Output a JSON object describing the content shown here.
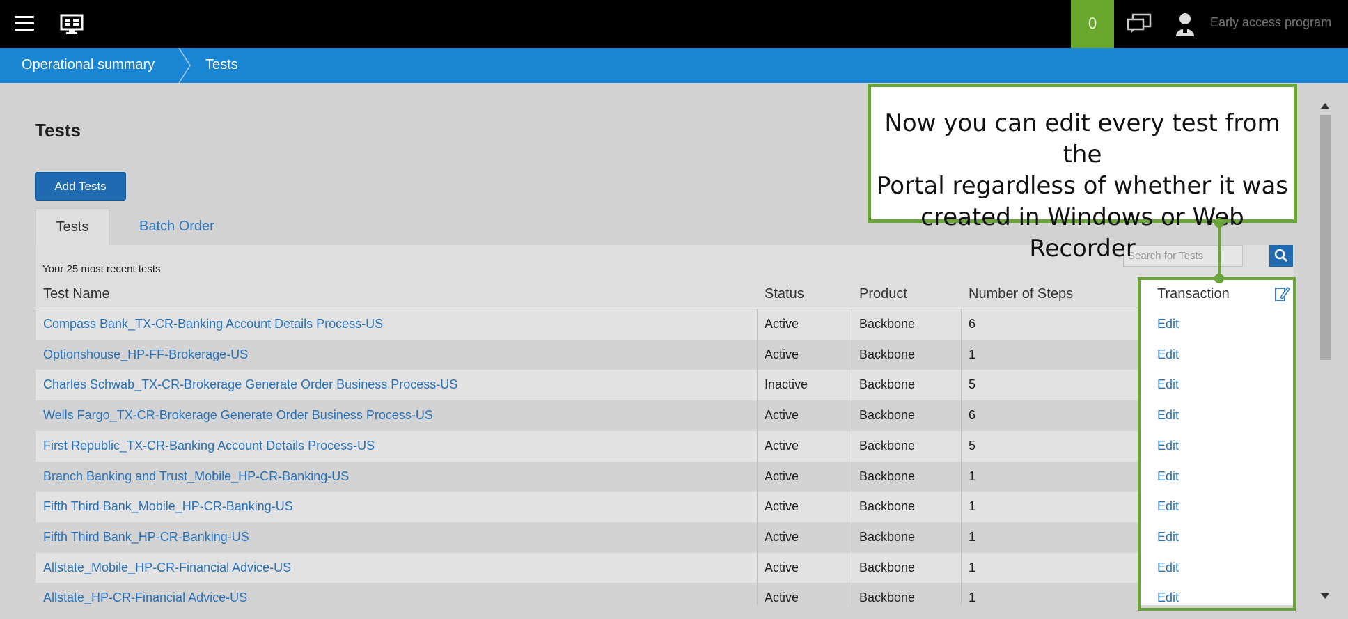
{
  "topbar": {
    "notification_count": "0",
    "early_access_label": "Early access program",
    "brand_green": "#6aa72d"
  },
  "breadcrumb": {
    "items": [
      "Operational summary",
      "Tests"
    ],
    "background": "#1a86d3"
  },
  "page": {
    "title": "Tests",
    "add_button_label": "Add Tests",
    "tabs": [
      {
        "label": "Tests",
        "active": true
      },
      {
        "label": "Batch Order",
        "active": false
      }
    ],
    "recent_label": "Your 25 most recent tests",
    "search_placeholder": "Search for Tests"
  },
  "table": {
    "headers": {
      "name": "Test Name",
      "status": "Status",
      "product": "Product",
      "steps": "Number of Steps",
      "transaction": "Transaction"
    },
    "rows": [
      {
        "name": "Compass Bank_TX-CR-Banking Account Details Process-US",
        "status": "Active",
        "product": "Backbone",
        "steps": "6",
        "action": "Edit"
      },
      {
        "name": "Optionshouse_HP-FF-Brokerage-US",
        "status": "Active",
        "product": "Backbone",
        "steps": "1",
        "action": "Edit"
      },
      {
        "name": "Charles Schwab_TX-CR-Brokerage Generate Order Business Process-US",
        "status": "Inactive",
        "product": "Backbone",
        "steps": "5",
        "action": "Edit"
      },
      {
        "name": "Wells Fargo_TX-CR-Brokerage Generate Order Business Process-US",
        "status": "Active",
        "product": "Backbone",
        "steps": "6",
        "action": "Edit"
      },
      {
        "name": "First Republic_TX-CR-Banking Account Details Process-US",
        "status": "Active",
        "product": "Backbone",
        "steps": "5",
        "action": "Edit"
      },
      {
        "name": "Branch Banking and Trust_Mobile_HP-CR-Banking-US",
        "status": "Active",
        "product": "Backbone",
        "steps": "1",
        "action": "Edit"
      },
      {
        "name": "Fifth Third Bank_Mobile_HP-CR-Banking-US",
        "status": "Active",
        "product": "Backbone",
        "steps": "1",
        "action": "Edit"
      },
      {
        "name": "Fifth Third Bank_HP-CR-Banking-US",
        "status": "Active",
        "product": "Backbone",
        "steps": "1",
        "action": "Edit"
      },
      {
        "name": "Allstate_Mobile_HP-CR-Financial Advice-US",
        "status": "Active",
        "product": "Backbone",
        "steps": "1",
        "action": "Edit"
      },
      {
        "name": "Allstate_HP-CR-Financial Advice-US",
        "status": "Active",
        "product": "Backbone",
        "steps": "1",
        "action": "Edit"
      }
    ]
  },
  "callout": {
    "lines": [
      "Now you can edit every test from the",
      "Portal regardless of whether it was",
      "created in Windows or Web Recorder"
    ],
    "border_color": "#6aa43a"
  },
  "icons": [
    "hamburger-icon",
    "monitor-icon",
    "chat-icon",
    "user-icon",
    "search-icon",
    "edit-pencil-icon"
  ]
}
